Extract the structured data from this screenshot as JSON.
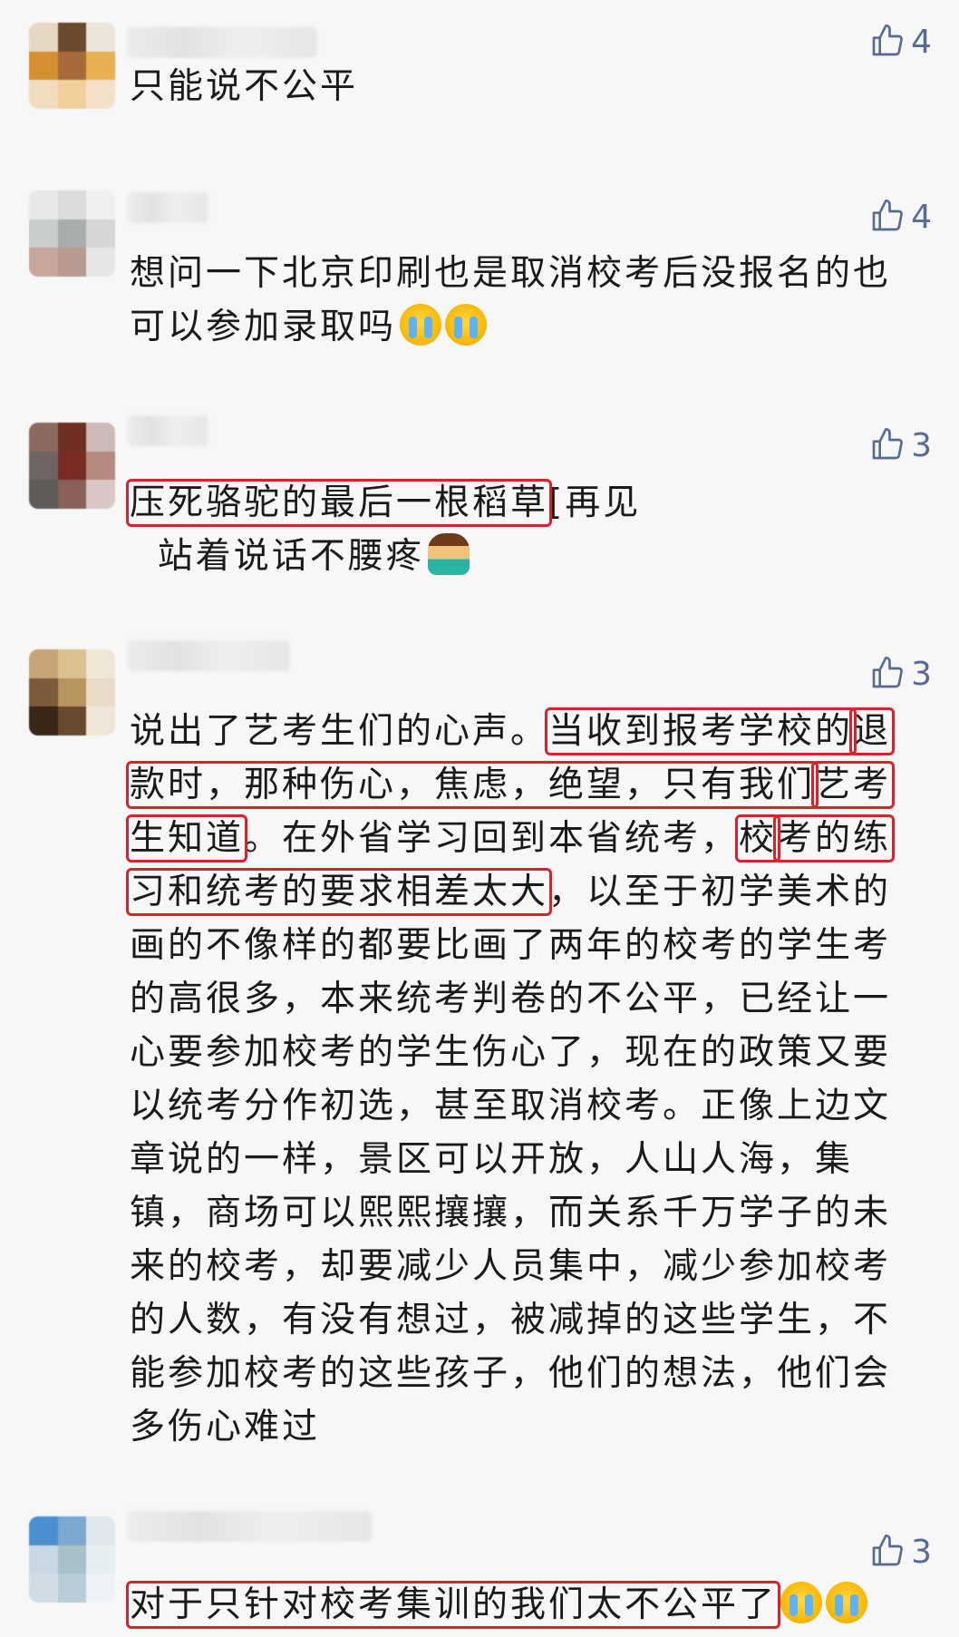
{
  "comments": [
    {
      "likes": "4",
      "text": "只能说不公平",
      "avatar_colors": [
        "#e6d8c4",
        "#6b4a2e",
        "#ece4d8",
        "#d48f2e",
        "#a86a3a",
        "#e8b050",
        "#f2dcc0",
        "#f0cf9a",
        "#f4e0c8"
      ]
    },
    {
      "likes": "4",
      "text_before": "想问一下北京印刷也是取消校考后没报名的也可以参加录取吗",
      "emoji": [
        "crying-face",
        "crying-face"
      ],
      "avatar_colors": [
        "#e8e8e8",
        "#dcdcdc",
        "#f0f0f0",
        "#c8cccc",
        "#a8aeae",
        "#d6d6d6",
        "#c7a79c",
        "#b99a90",
        "#e6e6e6"
      ]
    },
    {
      "likes": "3",
      "highlight": "压死骆驼的最后一根稻草",
      "after": "[再见",
      "line2": "站着说话不腰疼",
      "emoji": [
        "person-shrugging"
      ],
      "avatar_colors": [
        "#8b6a62",
        "#6e2e22",
        "#cdbab6",
        "#6f6562",
        "#7a2c24",
        "#b48a80",
        "#5f5b58",
        "#8a6058",
        "#d9c7c3"
      ]
    },
    {
      "likes": "3",
      "seg1": "说出了艺考生们的心声。",
      "hl1": "当收到报考学校的",
      "hl2": "退款时，那种伤心，焦虑，绝望，只有我们",
      "hl3": "艺考生知道",
      "seg2": "。在外省学习回到本省统考，",
      "hl4": "校",
      "hl5": "考的练习和统考的要求相差太大",
      "seg3": "，以至于初学美术的画的不像样的都要比画了两年的校考的学生考的高很多，本来统考判卷的不公平，已经让一心要参加校考的学生伤心了，现在的政策又要以统考分作初选，甚至取消校考。正像上边文章说的一样，景区可以开放，人山人海，集镇，商场可以熙熙攘攘，而关系千万学子的未来的校考，却要减少人员集中，减少参加校考的人数，有没有想过，被减掉的这些学生，不能参加校考的这些孩子，他们的想法，他们会多伤心难过",
      "avatar_colors": [
        "#c9a47a",
        "#dcc090",
        "#f0e6d6",
        "#7c5a3a",
        "#b7955f",
        "#e8dcc8",
        "#3a2616",
        "#6a4a2e",
        "#efe6d8"
      ]
    },
    {
      "likes": "3",
      "highlight": "对于只针对校考集训的我们太不公平了",
      "emoji": [
        "crying-face",
        "crying-face"
      ],
      "avatar_colors": [
        "#4a90d0",
        "#7aa8d0",
        "#dfe8ef",
        "#c8d8e4",
        "#a8c0c8",
        "#e6eef2",
        "#d0dde6",
        "#b8ccd6",
        "#eef2f4"
      ]
    }
  ],
  "colors": {
    "like_icon": "#576b95",
    "highlight_border": "#d8232a",
    "background": "#f7f7f7"
  }
}
